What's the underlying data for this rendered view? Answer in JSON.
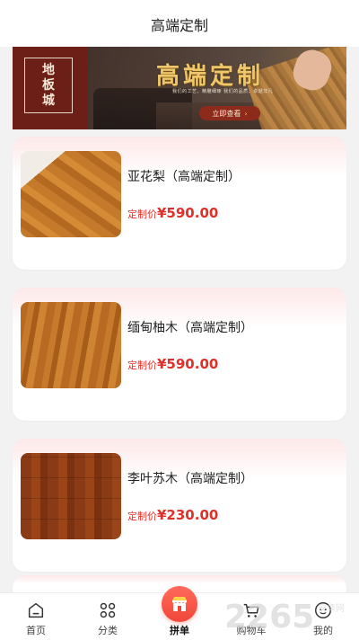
{
  "header": {
    "title": "高端定制"
  },
  "banner": {
    "logo_chars": [
      "地",
      "板",
      "城"
    ],
    "headline": "高端定制",
    "tagline": "我们的工艺，精雕细琢 我们的品质，卓越非凡",
    "cta_label": "立即查看"
  },
  "products": [
    {
      "name": "亚花梨（高端定制）",
      "price_label": "定制价",
      "price_value": "¥590.00"
    },
    {
      "name": "缅甸柚木（高端定制）",
      "price_label": "定制价",
      "price_value": "¥590.00"
    },
    {
      "name": "李叶苏木（高端定制）",
      "price_label": "定制价",
      "price_value": "¥230.00"
    }
  ],
  "nav": {
    "home": "首页",
    "category": "分类",
    "group_buy": "拼单",
    "cart": "购物车",
    "mine": "我的"
  },
  "colors": {
    "price": "#e0302a",
    "fab": "#f0473a",
    "banner_panel": "#6b1f16",
    "headline": "#f0c66a"
  },
  "icons": [
    "home-icon",
    "category-grid-icon",
    "shop-icon",
    "cart-icon",
    "user-icon"
  ]
}
